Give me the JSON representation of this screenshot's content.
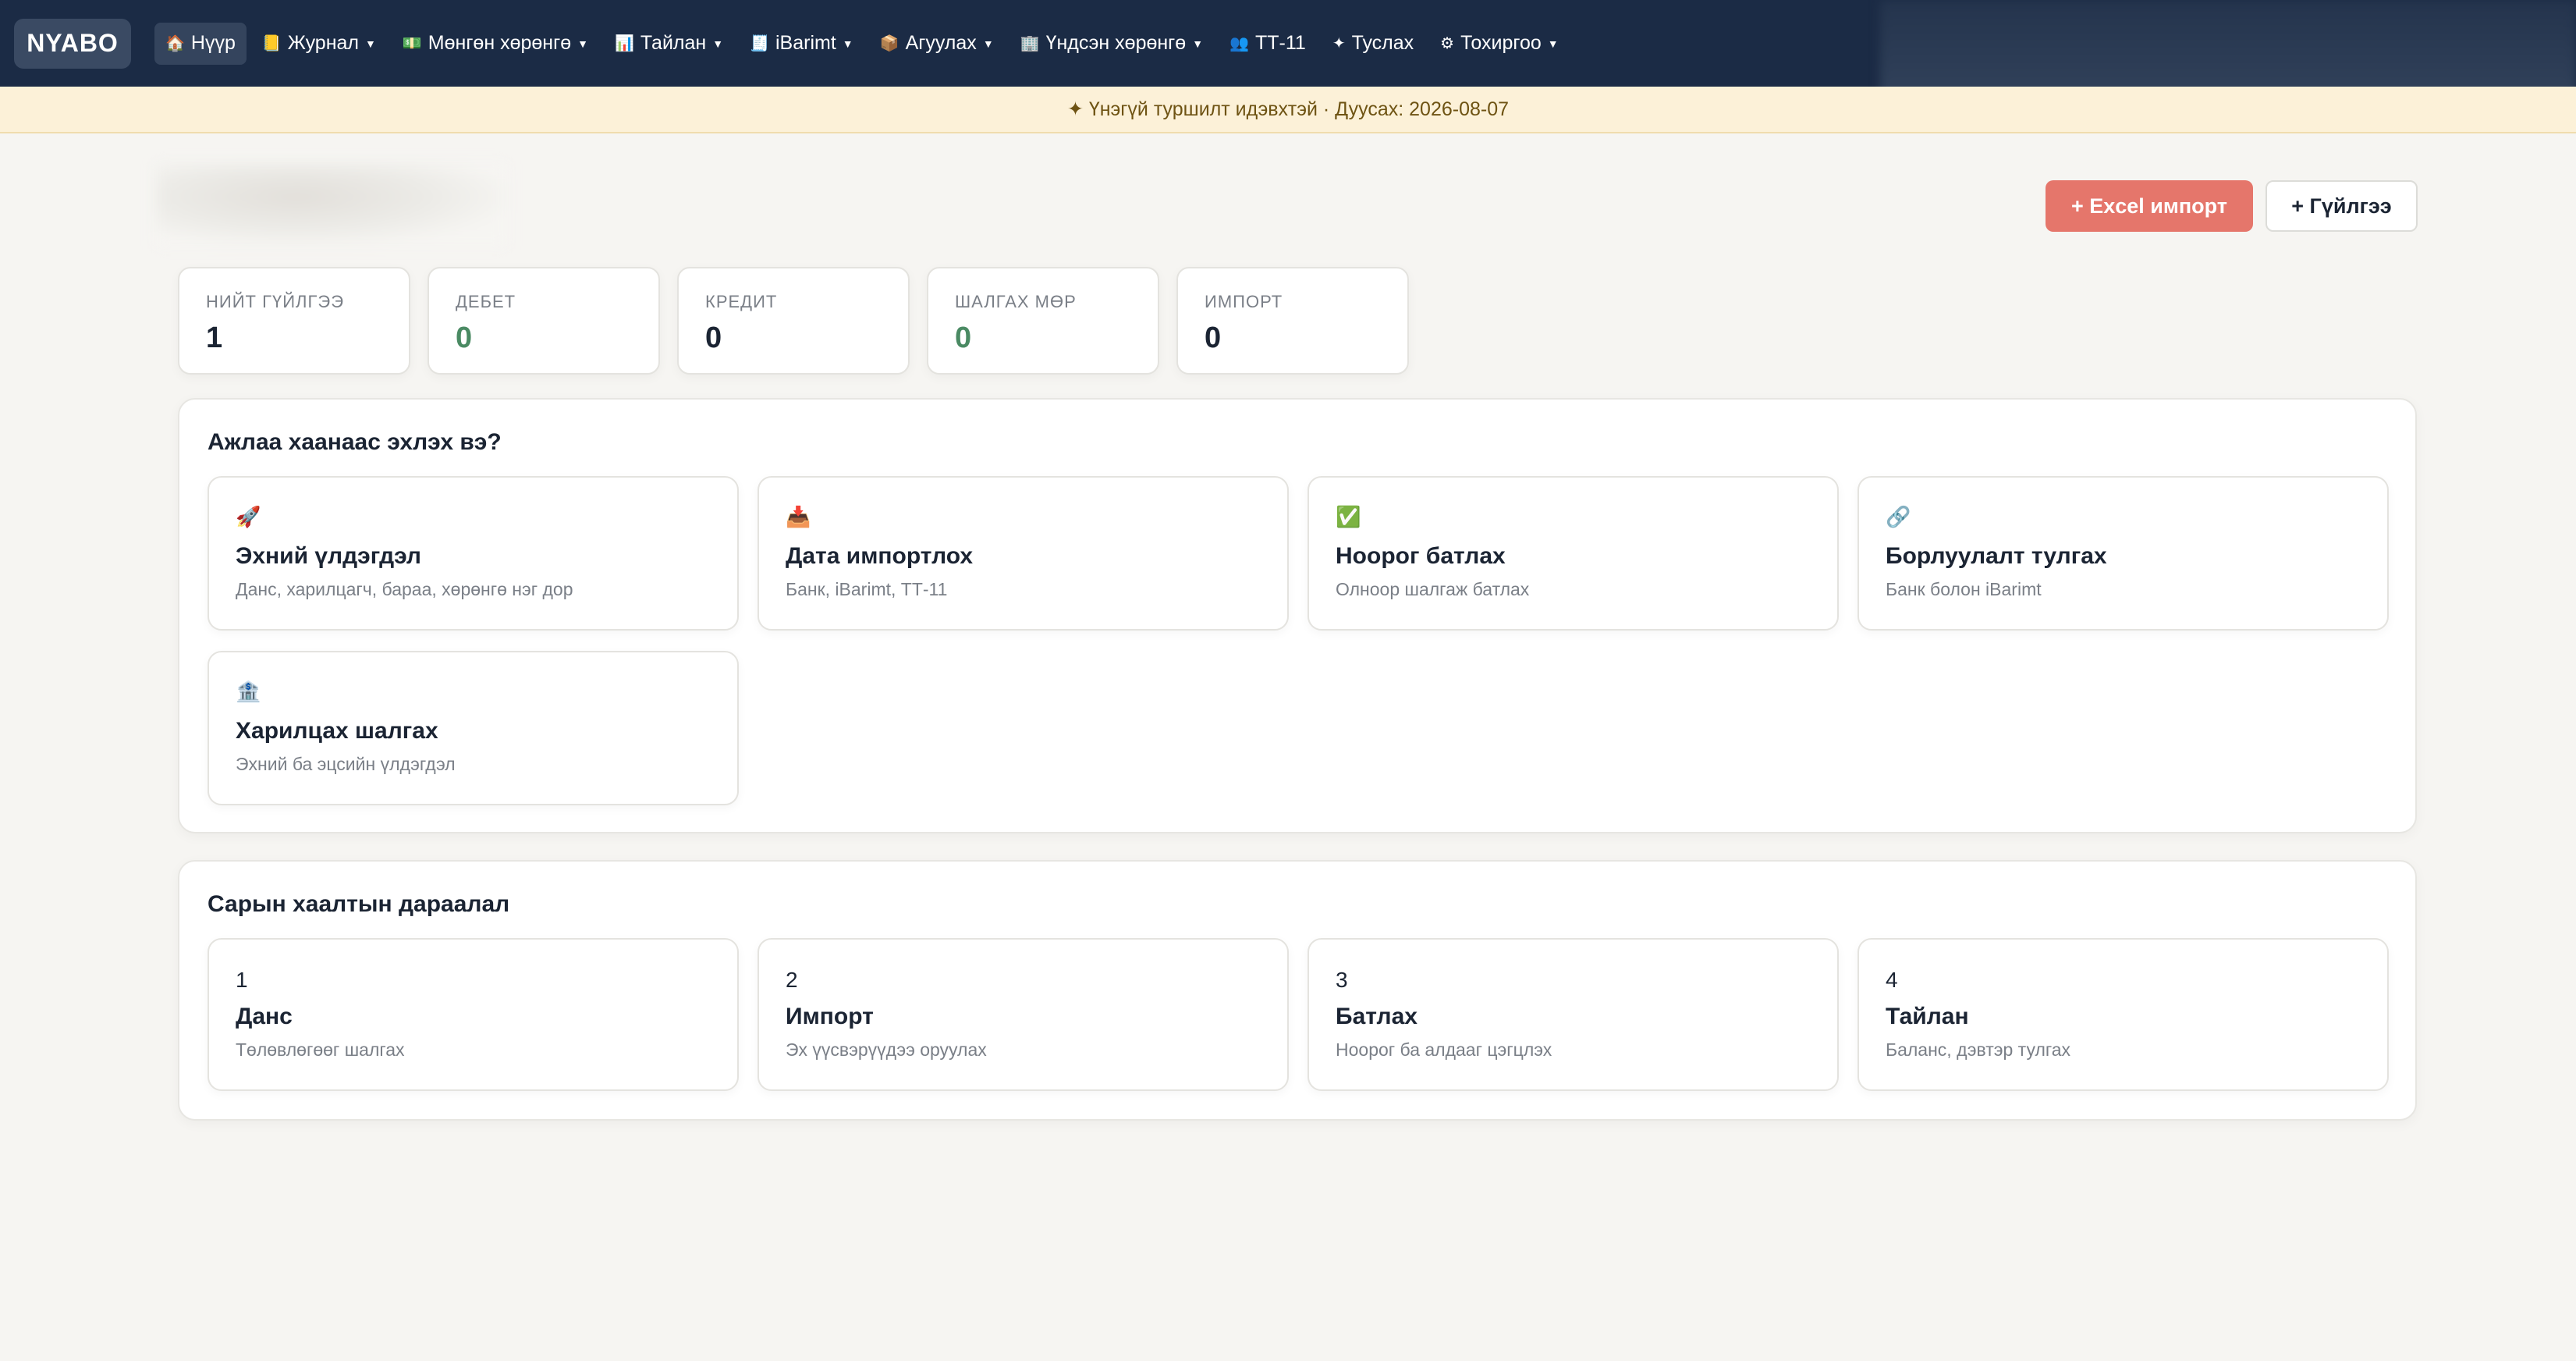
{
  "app": {
    "logo": "NYABO"
  },
  "nav": [
    {
      "icon": "🏠",
      "label": "Нүүр",
      "dropdown": false,
      "active": true,
      "name": "home"
    },
    {
      "icon": "📒",
      "label": "Журнал",
      "dropdown": true,
      "active": false,
      "name": "journal"
    },
    {
      "icon": "💵",
      "label": "Мөнгөн хөрөнгө",
      "dropdown": true,
      "active": false,
      "name": "cash"
    },
    {
      "icon": "📊",
      "label": "Тайлан",
      "dropdown": true,
      "active": false,
      "name": "reports"
    },
    {
      "icon": "🧾",
      "label": "iBarimt",
      "dropdown": true,
      "active": false,
      "name": "ibarimt"
    },
    {
      "icon": "📦",
      "label": "Агуулах",
      "dropdown": true,
      "active": false,
      "name": "warehouse"
    },
    {
      "icon": "🏢",
      "label": "Үндсэн хөрөнгө",
      "dropdown": true,
      "active": false,
      "name": "fixed-assets"
    },
    {
      "icon": "👥",
      "label": "ТТ-11",
      "dropdown": false,
      "active": false,
      "name": "tt11"
    },
    {
      "icon": "✦",
      "label": "Туслах",
      "dropdown": false,
      "active": false,
      "name": "assistant"
    },
    {
      "icon": "⚙",
      "label": "Тохиргоо",
      "dropdown": true,
      "active": false,
      "name": "settings"
    }
  ],
  "banner": {
    "text": "✦ Үнэгүй туршилт идэвхтэй · Дуусах: 2026-08-07"
  },
  "actions": {
    "excel_import": "+ Excel импорт",
    "new_transaction": "+ Гүйлгээ"
  },
  "stats": [
    {
      "label": "НИЙТ ГҮЙЛГЭЭ",
      "value": "1",
      "color": "#1b2433",
      "name": "total-transactions"
    },
    {
      "label": "ДЕБЕТ",
      "value": "0",
      "color": "#4a8a63",
      "name": "debit"
    },
    {
      "label": "КРЕДИТ",
      "value": "0",
      "color": "#1b2433",
      "name": "credit"
    },
    {
      "label": "ШАЛГАХ МӨР",
      "value": "0",
      "color": "#4a8a63",
      "name": "rows-to-check"
    },
    {
      "label": "ИМПОРТ",
      "value": "0",
      "color": "#1b2433",
      "name": "import"
    }
  ],
  "start_panel": {
    "title": "Ажлаа хаанаас эхлэх вэ?",
    "cards": [
      {
        "icon": "🚀",
        "icon_name": "rocket-icon",
        "title": "Эхний үлдэгдэл",
        "subtitle": "Данс, харилцагч, бараа, хөрөнгө нэг дор",
        "name": "opening-balance"
      },
      {
        "icon": "📥",
        "icon_name": "inbox-import-icon",
        "title": "Дата импортлох",
        "subtitle": "Банк, iBarimt, ТТ-11",
        "name": "data-import"
      },
      {
        "icon": "✅",
        "icon_name": "check-icon",
        "title": "Ноорог батлах",
        "subtitle": "Олноор шалгаж батлах",
        "name": "approve-drafts"
      },
      {
        "icon": "🔗",
        "icon_name": "link-icon",
        "title": "Борлуулалт тулгах",
        "subtitle": "Банк болон iBarimt",
        "name": "sales-reconcile"
      },
      {
        "icon": "🏦",
        "icon_name": "bank-icon",
        "title": "Харилцах шалгах",
        "subtitle": "Эхний ба эцсийн үлдэгдэл",
        "name": "check-current-account"
      }
    ]
  },
  "close_panel": {
    "title": "Сарын хаалтын дараалал",
    "steps": [
      {
        "num": "1",
        "title": "Данс",
        "subtitle": "Төлөвлөгөөг шалгах",
        "name": "accounts"
      },
      {
        "num": "2",
        "title": "Импорт",
        "subtitle": "Эх үүсвэрүүдээ оруулах",
        "name": "import"
      },
      {
        "num": "3",
        "title": "Батлах",
        "subtitle": "Ноорог ба алдааг цэгцлэх",
        "name": "approve"
      },
      {
        "num": "4",
        "title": "Тайлан",
        "subtitle": "Баланс, дэвтэр тулгах",
        "name": "report"
      }
    ]
  }
}
